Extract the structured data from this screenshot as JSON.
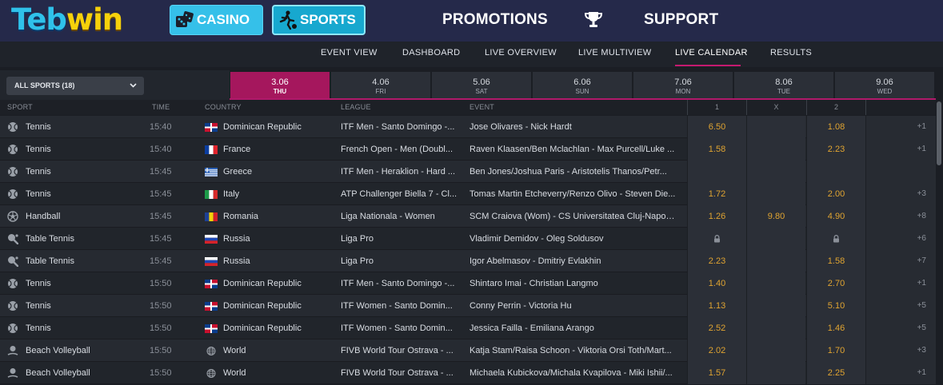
{
  "header": {
    "logo_part1": "Teb",
    "logo_part2": "win",
    "casino_label": "CASINO",
    "sports_label": "SPORTS",
    "promotions_label": "PROMOTIONS",
    "support_label": "SUPPORT",
    "icons": {
      "casino": "dice-icon",
      "sports": "soccer-player-icon",
      "promotions": "trophy-icon"
    }
  },
  "subnav": [
    "EVENT VIEW",
    "DASHBOARD",
    "LIVE OVERVIEW",
    "LIVE MULTIVIEW",
    "LIVE CALENDAR",
    "RESULTS"
  ],
  "subnav_active": "LIVE CALENDAR",
  "filter": {
    "selected": "ALL SPORTS (18)"
  },
  "dates": [
    {
      "date": "3.06",
      "day": "THU",
      "active": true
    },
    {
      "date": "4.06",
      "day": "FRI"
    },
    {
      "date": "5.06",
      "day": "SAT"
    },
    {
      "date": "6.06",
      "day": "SUN"
    },
    {
      "date": "7.06",
      "day": "MON"
    },
    {
      "date": "8.06",
      "day": "TUE"
    },
    {
      "date": "9.06",
      "day": "WED"
    }
  ],
  "table": {
    "headers": {
      "sport": "SPORT",
      "time": "TIME",
      "country": "COUNTRY",
      "league": "LEAGUE",
      "event": "EVENT",
      "o1": "1",
      "ox": "X",
      "o2": "2"
    },
    "rows": [
      {
        "sport": "Tennis",
        "icon": "tennis-ball-icon",
        "time": "15:40",
        "flag": "do",
        "country": "Dominican Republic",
        "league": "ITF Men - Santo Domingo -...",
        "event": "Jose Olivares - Nick Hardt",
        "o1": "6.50",
        "ox": "",
        "o2": "1.08",
        "more": "+1"
      },
      {
        "sport": "Tennis",
        "icon": "tennis-ball-icon",
        "time": "15:40",
        "flag": "fr",
        "country": "France",
        "league": "French Open - Men (Doubl...",
        "event": "Raven Klaasen/Ben Mclachlan - Max Purcell/Luke ...",
        "o1": "1.58",
        "ox": "",
        "o2": "2.23",
        "more": "+1"
      },
      {
        "sport": "Tennis",
        "icon": "tennis-ball-icon",
        "time": "15:45",
        "flag": "gr",
        "country": "Greece",
        "league": "ITF Men - Heraklion - Hard ...",
        "event": "Ben Jones/Joshua Paris - Aristotelis Thanos/Petr...",
        "o1": "",
        "ox": "",
        "o2": "",
        "more": ""
      },
      {
        "sport": "Tennis",
        "icon": "tennis-ball-icon",
        "time": "15:45",
        "flag": "it",
        "country": "Italy",
        "league": "ATP Challenger Biella 7 - Cl...",
        "event": "Tomas Martin Etcheverry/Renzo Olivo - Steven Die...",
        "o1": "1.72",
        "ox": "",
        "o2": "2.00",
        "more": "+3"
      },
      {
        "sport": "Handball",
        "icon": "handball-icon",
        "time": "15:45",
        "flag": "ro",
        "country": "Romania",
        "league": "Liga Nationala - Women",
        "event": "SCM Craiova (Wom) - CS Universitatea Cluj-Napoc...",
        "o1": "1.26",
        "ox": "9.80",
        "o2": "4.90",
        "more": "+8"
      },
      {
        "sport": "Table Tennis",
        "icon": "table-tennis-icon",
        "time": "15:45",
        "flag": "ru",
        "country": "Russia",
        "league": "Liga Pro",
        "event": "Vladimir Demidov - Oleg Soldusov",
        "o1": "lock",
        "ox": "",
        "o2": "lock",
        "more": "+6"
      },
      {
        "sport": "Table Tennis",
        "icon": "table-tennis-icon",
        "time": "15:45",
        "flag": "ru",
        "country": "Russia",
        "league": "Liga Pro",
        "event": "Igor Abelmasov - Dmitriy Evlakhin",
        "o1": "2.23",
        "ox": "",
        "o2": "1.58",
        "more": "+7"
      },
      {
        "sport": "Tennis",
        "icon": "tennis-ball-icon",
        "time": "15:50",
        "flag": "do",
        "country": "Dominican Republic",
        "league": "ITF Men - Santo Domingo -...",
        "event": "Shintaro Imai - Christian Langmo",
        "o1": "1.40",
        "ox": "",
        "o2": "2.70",
        "more": "+1"
      },
      {
        "sport": "Tennis",
        "icon": "tennis-ball-icon",
        "time": "15:50",
        "flag": "do",
        "country": "Dominican Republic",
        "league": "ITF Women - Santo Domin...",
        "event": "Conny Perrin - Victoria Hu",
        "o1": "1.13",
        "ox": "",
        "o2": "5.10",
        "more": "+5"
      },
      {
        "sport": "Tennis",
        "icon": "tennis-ball-icon",
        "time": "15:50",
        "flag": "do",
        "country": "Dominican Republic",
        "league": "ITF Women - Santo Domin...",
        "event": "Jessica Failla - Emiliana Arango",
        "o1": "2.52",
        "ox": "",
        "o2": "1.46",
        "more": "+5"
      },
      {
        "sport": "Beach Volleyball",
        "icon": "beach-volleyball-icon",
        "time": "15:50",
        "flag": "world",
        "country": "World",
        "league": "FIVB World Tour Ostrava - ...",
        "event": "Katja Stam/Raisa Schoon - Viktoria Orsi Toth/Mart...",
        "o1": "2.02",
        "ox": "",
        "o2": "1.70",
        "more": "+3"
      },
      {
        "sport": "Beach Volleyball",
        "icon": "beach-volleyball-icon",
        "time": "15:50",
        "flag": "world",
        "country": "World",
        "league": "FIVB World Tour Ostrava - ...",
        "event": "Michaela Kubickova/Michala Kvapilova - Miki Ishii/...",
        "o1": "1.57",
        "ox": "",
        "o2": "2.25",
        "more": "+1"
      }
    ]
  },
  "colors": {
    "header_bg": "#25294a",
    "accent": "#a5175d",
    "odds": "#e0a431",
    "casino_btn": "#35c0e9",
    "sports_btn": "#17a8cf"
  }
}
